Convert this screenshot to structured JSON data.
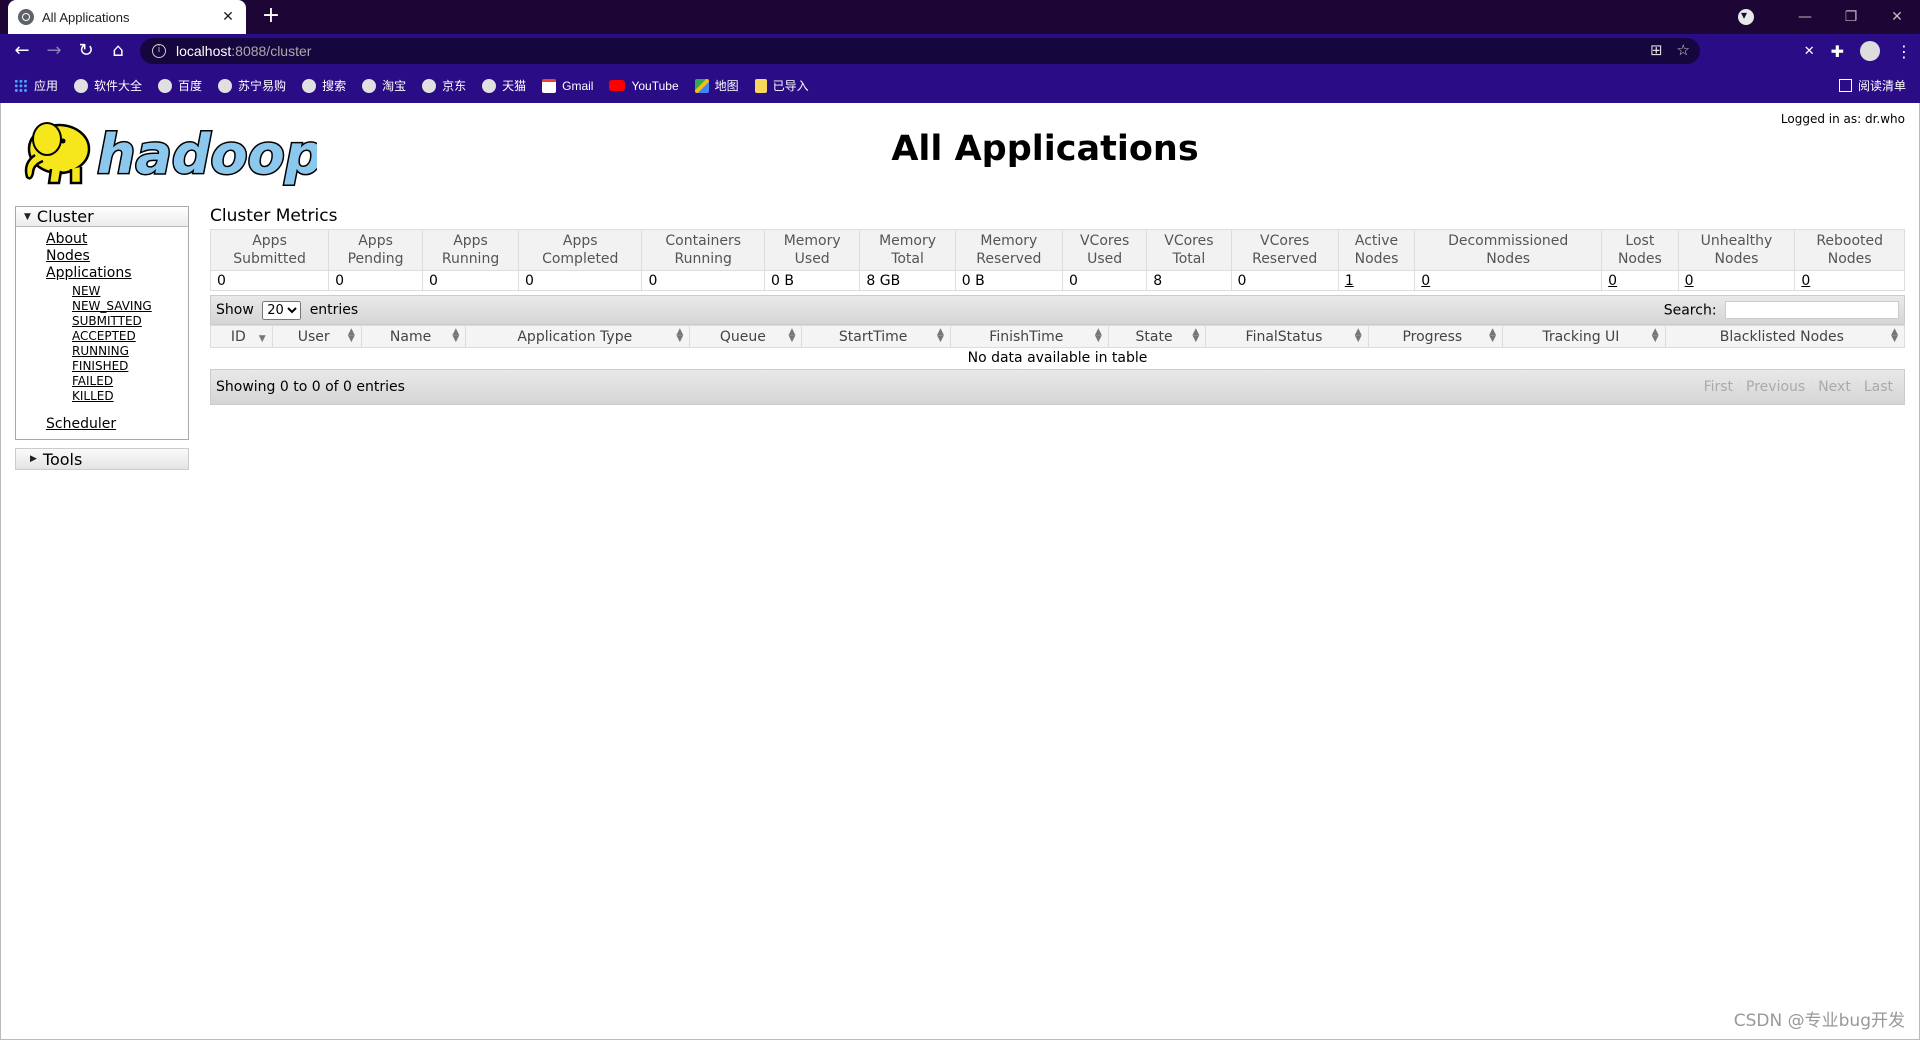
{
  "browser": {
    "tab_title": "All Applications",
    "url_host": "localhost",
    "url_path": ":8088/cluster",
    "bookmarks": [
      "应用",
      "软件大全",
      "百度",
      "苏宁易购",
      "搜索",
      "淘宝",
      "京东",
      "天猫",
      "Gmail",
      "YouTube",
      "地图",
      "已导入"
    ],
    "reading_list": "阅读清单"
  },
  "header": {
    "logged_in": "Logged in as: dr.who",
    "title": "All Applications",
    "logo_text": "hadoop"
  },
  "nav": {
    "cluster_label": "Cluster",
    "links": [
      "About",
      "Nodes",
      "Applications"
    ],
    "app_states": [
      "NEW",
      "NEW_SAVING",
      "SUBMITTED",
      "ACCEPTED",
      "RUNNING",
      "FINISHED",
      "FAILED",
      "KILLED"
    ],
    "scheduler": "Scheduler",
    "tools_label": "Tools"
  },
  "metrics": {
    "title": "Cluster Metrics",
    "headers": [
      [
        "Apps",
        "Submitted"
      ],
      [
        "Apps",
        "Pending"
      ],
      [
        "Apps",
        "Running"
      ],
      [
        "Apps",
        "Completed"
      ],
      [
        "Containers",
        "Running"
      ],
      [
        "Memory",
        "Used"
      ],
      [
        "Memory",
        "Total"
      ],
      [
        "Memory",
        "Reserved"
      ],
      [
        "VCores",
        "Used"
      ],
      [
        "VCores",
        "Total"
      ],
      [
        "VCores",
        "Reserved"
      ],
      [
        "Active",
        "Nodes"
      ],
      [
        "Decommissioned",
        "Nodes"
      ],
      [
        "Lost",
        "Nodes"
      ],
      [
        "Unhealthy",
        "Nodes"
      ],
      [
        "Rebooted",
        "Nodes"
      ]
    ],
    "values": [
      "0",
      "0",
      "0",
      "0",
      "0",
      "0 B",
      "8 GB",
      "0 B",
      "0",
      "8",
      "0",
      "1",
      "0",
      "0",
      "0",
      "0"
    ]
  },
  "apps_table": {
    "show_label": "Show",
    "page_size": "20",
    "entries_label": "entries",
    "search_label": "Search:",
    "columns": [
      "ID",
      "User",
      "Name",
      "Application Type",
      "Queue",
      "StartTime",
      "FinishTime",
      "State",
      "FinalStatus",
      "Progress",
      "Tracking UI",
      "Blacklisted Nodes"
    ],
    "empty_message": "No data available in table",
    "info": "Showing 0 to 0 of 0 entries",
    "pager": [
      "First",
      "Previous",
      "Next",
      "Last"
    ]
  },
  "watermark": "CSDN @专业bug开发"
}
